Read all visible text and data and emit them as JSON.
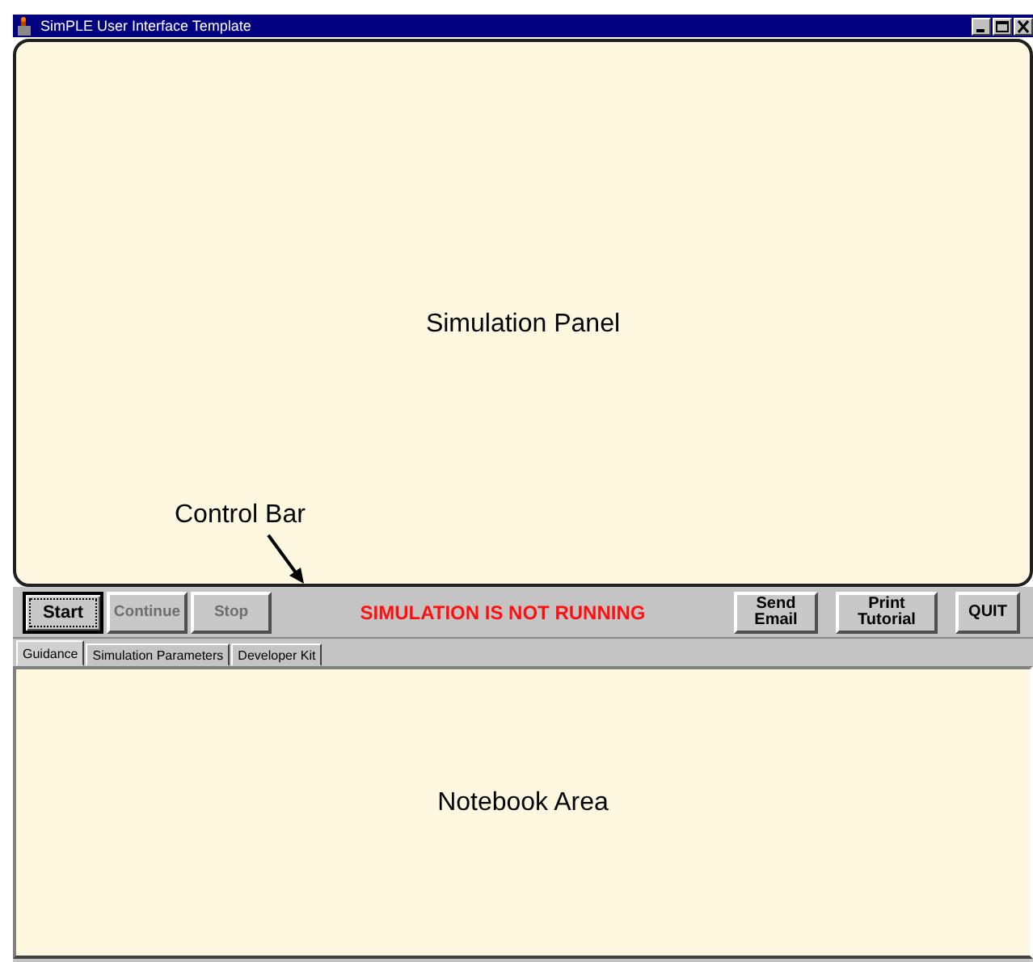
{
  "window": {
    "title": "SimPLE User Interface Template"
  },
  "simulation_panel": {
    "label": "Simulation Panel",
    "annotation": "Control Bar"
  },
  "control_bar": {
    "buttons": [
      {
        "label": "Start",
        "disabled": false,
        "focused": true
      },
      {
        "label": "Continue",
        "disabled": true,
        "focused": false
      },
      {
        "label": "Stop",
        "disabled": true,
        "focused": false
      }
    ],
    "status": "SIMULATION IS NOT RUNNING",
    "action_buttons": [
      {
        "label": "Send Email",
        "disabled": false,
        "focused": false
      },
      {
        "label": "Print Tutorial",
        "disabled": false,
        "focused": false
      },
      {
        "label": "QUIT",
        "disabled": false,
        "focused": false
      }
    ]
  },
  "tabs": [
    {
      "label": "Guidance",
      "selected": true
    },
    {
      "label": "Simulation Parameters",
      "selected": false
    },
    {
      "label": "Developer Kit",
      "selected": false
    }
  ],
  "notebook": {
    "label": "Notebook Area"
  }
}
